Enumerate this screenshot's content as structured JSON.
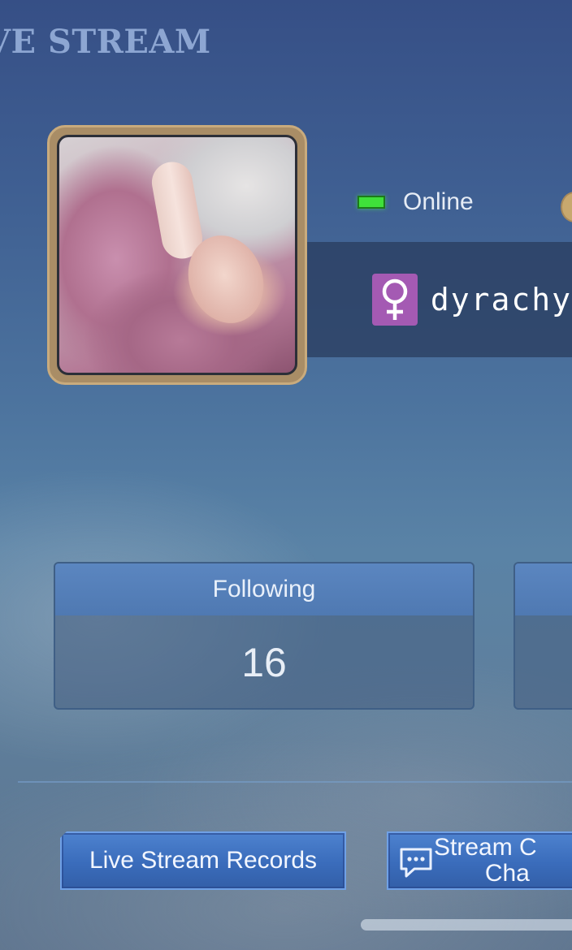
{
  "header": {
    "title": "VE STREAM"
  },
  "profile": {
    "avatar_icon": "user-avatar-photo",
    "status": {
      "label": "Online",
      "color": "#3fe03a"
    },
    "gender_icon": "female-symbol-icon",
    "gender_color": "#a45ab3",
    "username": "dyrachy"
  },
  "stats": [
    {
      "label": "Following",
      "value": "16"
    },
    {
      "label": "",
      "value": ""
    }
  ],
  "actions": {
    "records_label": "Live Stream Records",
    "chat_label_line1": "Stream C",
    "chat_label_line2": "Cha",
    "chat_icon": "chat-bubble-icon"
  },
  "colors": {
    "accent": "#4d82cf",
    "title": "#8da6d2",
    "frame": "#a98d66"
  }
}
